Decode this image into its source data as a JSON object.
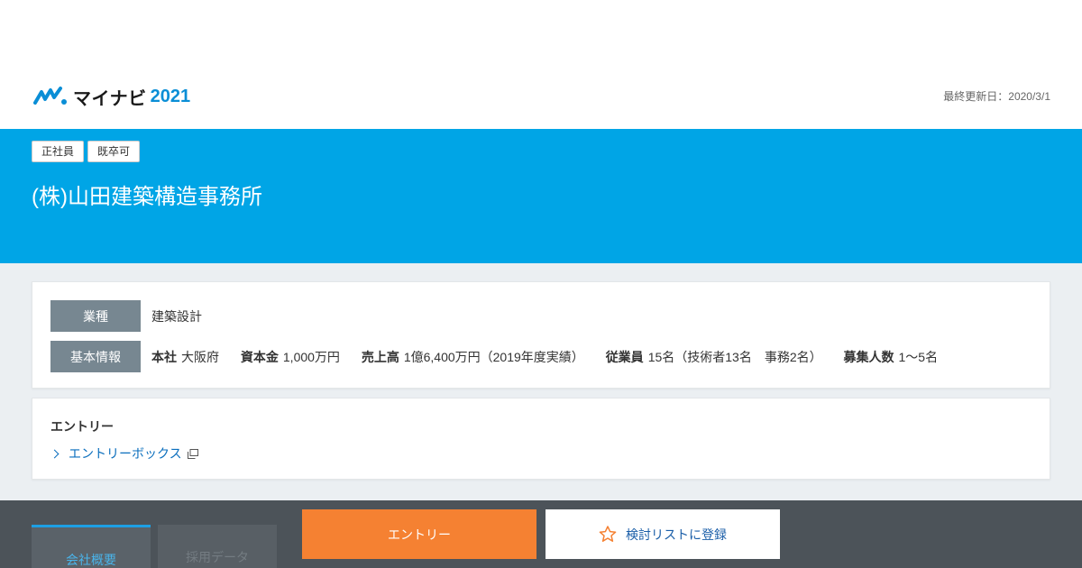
{
  "header": {
    "logo_text": "マイナビ",
    "logo_year": "2021",
    "last_updated": "最終更新日：2020/3/1"
  },
  "hero": {
    "tags": [
      "正社員",
      "既卒可"
    ],
    "company_name": "(株)山田建築構造事務所"
  },
  "info": {
    "industry_label": "業種",
    "industry_value": "建築設計",
    "basic_label": "基本情報",
    "basic_items": [
      {
        "key": "本社",
        "value": "大阪府"
      },
      {
        "key": "資本金",
        "value": "1,000万円"
      },
      {
        "key": "売上高",
        "value": "1億6,400万円（2019年度実績）"
      },
      {
        "key": "従業員",
        "value": "15名（技術者13名　事務2名）"
      },
      {
        "key": "募集人数",
        "value": "1～5名"
      }
    ]
  },
  "entry": {
    "title": "エントリー",
    "link_label": "エントリーボックス"
  },
  "footer": {
    "tab_overview": "会社概要",
    "tab_recruit": "採用データ",
    "entry_button": "エントリー",
    "list_button": "検討リストに登録"
  },
  "colors": {
    "brand_blue": "#00a5e6",
    "entry_orange": "#f58132",
    "label_gray": "#778791"
  },
  "icons": {
    "logo": "mynavi-logo-icon",
    "chevron": "chevron-right-icon",
    "external": "external-window-icon",
    "star": "star-outline-icon"
  }
}
